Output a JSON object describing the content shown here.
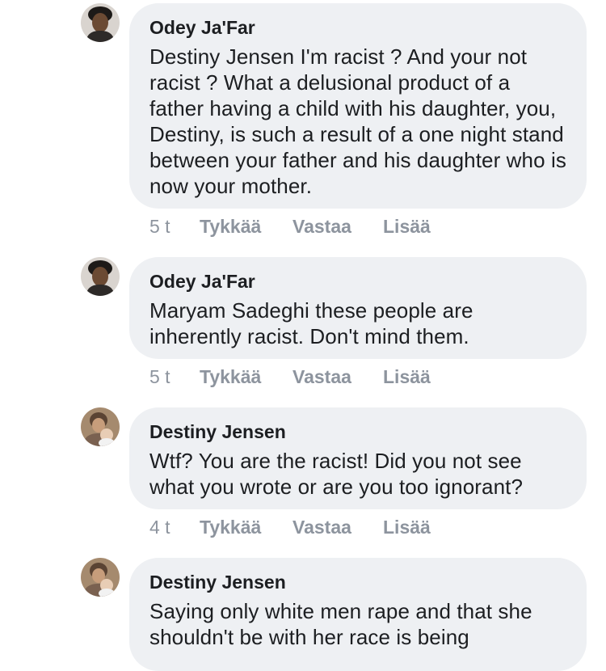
{
  "comments": [
    {
      "author": "Odey Ja'Far",
      "text": "Destiny Jensen I'm racist ? And your not racist ? What a delusional product of a father having a child with his daughter, you, Destiny, is such a result of a one night stand between your father and his daughter who is now your mother.",
      "time": "5 t",
      "like": "Tykkää",
      "reply": "Vastaa",
      "more": "Lisää",
      "avatar_icon": "profile-photo-icon"
    },
    {
      "author": "Odey Ja'Far",
      "text": "Maryam Sadeghi these people are inherently racist. Don't mind them.",
      "time": "5 t",
      "like": "Tykkää",
      "reply": "Vastaa",
      "more": "Lisää",
      "avatar_icon": "profile-photo-icon"
    },
    {
      "author": "Destiny Jensen",
      "text": "Wtf? You are the racist! Did you not see what you wrote or are you too ignorant?",
      "time": "4 t",
      "like": "Tykkää",
      "reply": "Vastaa",
      "more": "Lisää",
      "avatar_icon": "profile-photo-icon"
    },
    {
      "author": "Destiny Jensen",
      "text": "Saying only white men rape and that she shouldn't be with her race is being",
      "avatar_icon": "profile-photo-icon"
    }
  ],
  "colors": {
    "bubble_bg": "#eef0f3",
    "text": "#1c1e21",
    "action_text": "#8d949e",
    "background": "#ffffff"
  }
}
